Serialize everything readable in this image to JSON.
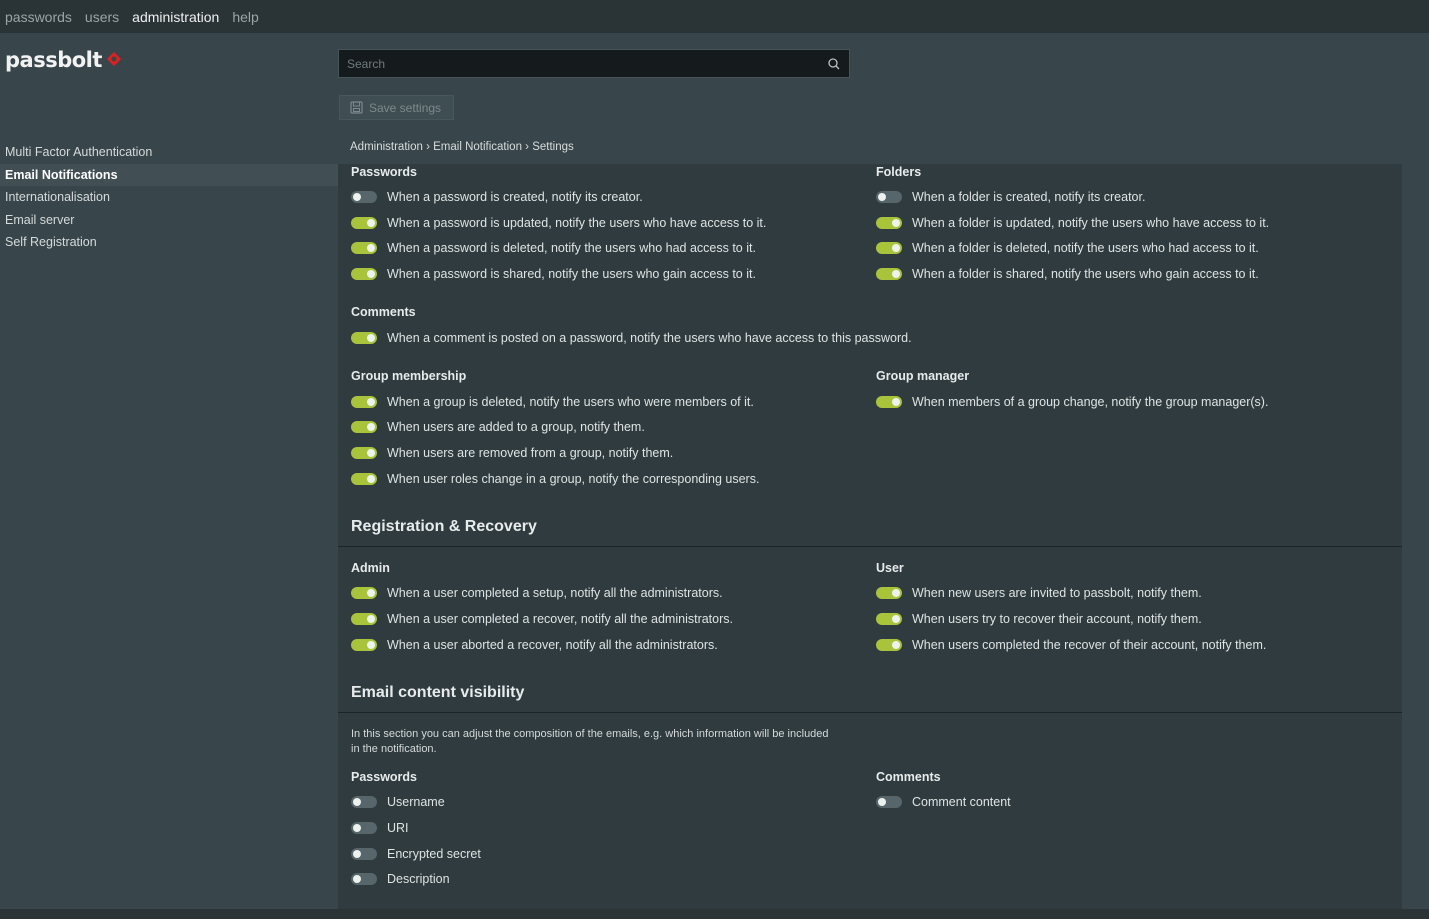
{
  "topnav": {
    "items": [
      "passwords",
      "users",
      "administration",
      "help"
    ],
    "active": "administration"
  },
  "brand": {
    "name": "passbolt",
    "accent": "#e02020"
  },
  "search": {
    "placeholder": "Search"
  },
  "toolbar": {
    "save_label": "Save settings"
  },
  "sidebar": {
    "items": [
      {
        "label": "Multi Factor Authentication",
        "selected": false
      },
      {
        "label": "Email Notifications",
        "selected": true
      },
      {
        "label": "Internationalisation",
        "selected": false
      },
      {
        "label": "Email server",
        "selected": false
      },
      {
        "label": "Self Registration",
        "selected": false
      }
    ]
  },
  "breadcrumb": [
    "Administration",
    "Email Notification",
    "Settings"
  ],
  "breadcrumb_separator": "›",
  "colors": {
    "toggle_on": "#a9c33a",
    "toggle_off": "#56666b"
  },
  "groups": {
    "passwords": {
      "title": "Passwords",
      "items": [
        {
          "label": "When a password is created, notify its creator.",
          "on": false
        },
        {
          "label": "When a password is updated, notify the users who have access to it.",
          "on": true
        },
        {
          "label": "When a password is deleted, notify the users who had access to it.",
          "on": true
        },
        {
          "label": "When a password is shared, notify the users who gain access to it.",
          "on": true
        }
      ]
    },
    "folders": {
      "title": "Folders",
      "items": [
        {
          "label": "When a folder is created, notify its creator.",
          "on": false
        },
        {
          "label": "When a folder is updated, notify the users who have access to it.",
          "on": true
        },
        {
          "label": "When a folder is deleted, notify the users who had access to it.",
          "on": true
        },
        {
          "label": "When a folder is shared, notify the users who gain access to it.",
          "on": true
        }
      ]
    },
    "comments": {
      "title": "Comments",
      "items": [
        {
          "label": "When a comment is posted on a password, notify the users who have access to this password.",
          "on": true
        }
      ]
    },
    "group_membership": {
      "title": "Group membership",
      "items": [
        {
          "label": "When a group is deleted, notify the users who were members of it.",
          "on": true
        },
        {
          "label": "When users are added to a group, notify them.",
          "on": true
        },
        {
          "label": "When users are removed from a group, notify them.",
          "on": true
        },
        {
          "label": "When user roles change in a group, notify the corresponding users.",
          "on": true
        }
      ]
    },
    "group_manager": {
      "title": "Group manager",
      "items": [
        {
          "label": "When members of a group change, notify the group manager(s).",
          "on": true
        }
      ]
    }
  },
  "registration": {
    "title": "Registration & Recovery",
    "admin": {
      "title": "Admin",
      "items": [
        {
          "label": "When a user completed a setup, notify all the administrators.",
          "on": true
        },
        {
          "label": "When a user completed a recover, notify all the administrators.",
          "on": true
        },
        {
          "label": "When a user aborted a recover, notify all the administrators.",
          "on": true
        }
      ]
    },
    "user": {
      "title": "User",
      "items": [
        {
          "label": "When new users are invited to passbolt, notify them.",
          "on": true
        },
        {
          "label": "When users try to recover their account, notify them.",
          "on": true
        },
        {
          "label": "When users completed the recover of their account, notify them.",
          "on": true
        }
      ]
    }
  },
  "visibility": {
    "title": "Email content visibility",
    "intro": "In this section you can adjust the composition of the emails, e.g. which information will be included in the notification.",
    "passwords": {
      "title": "Passwords",
      "items": [
        {
          "label": "Username",
          "on": false
        },
        {
          "label": "URI",
          "on": false
        },
        {
          "label": "Encrypted secret",
          "on": false
        },
        {
          "label": "Description",
          "on": false
        }
      ]
    },
    "comments": {
      "title": "Comments",
      "items": [
        {
          "label": "Comment content",
          "on": false
        }
      ]
    }
  }
}
